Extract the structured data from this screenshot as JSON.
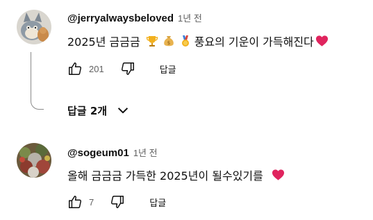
{
  "comments": [
    {
      "author": "@jerryalwaysbeloved",
      "time": "1년 전",
      "text": "2025년 금금금",
      "text_after": "풍요의 기운이 가득해진다",
      "emojis": [
        "trophy-emoji",
        "money-bag-emoji",
        "medal-emoji",
        "red-heart-emoji"
      ],
      "likes": "201",
      "reply_label": "답글",
      "replies_toggle": "답글 2개"
    },
    {
      "author": "@sogeum01",
      "time": "1년 전",
      "text": "올해 금금금 가득한 2025년이 될수있기를",
      "emojis": [
        "red-heart-emoji"
      ],
      "likes": "7",
      "reply_label": "답글"
    }
  ],
  "icons": {
    "like": "thumbs-up-icon",
    "dislike": "thumbs-down-icon",
    "expand": "chevron-down-icon"
  },
  "colors": {
    "text_primary": "#0f0f0f",
    "text_secondary": "#606060",
    "heart": "#e0245e"
  }
}
